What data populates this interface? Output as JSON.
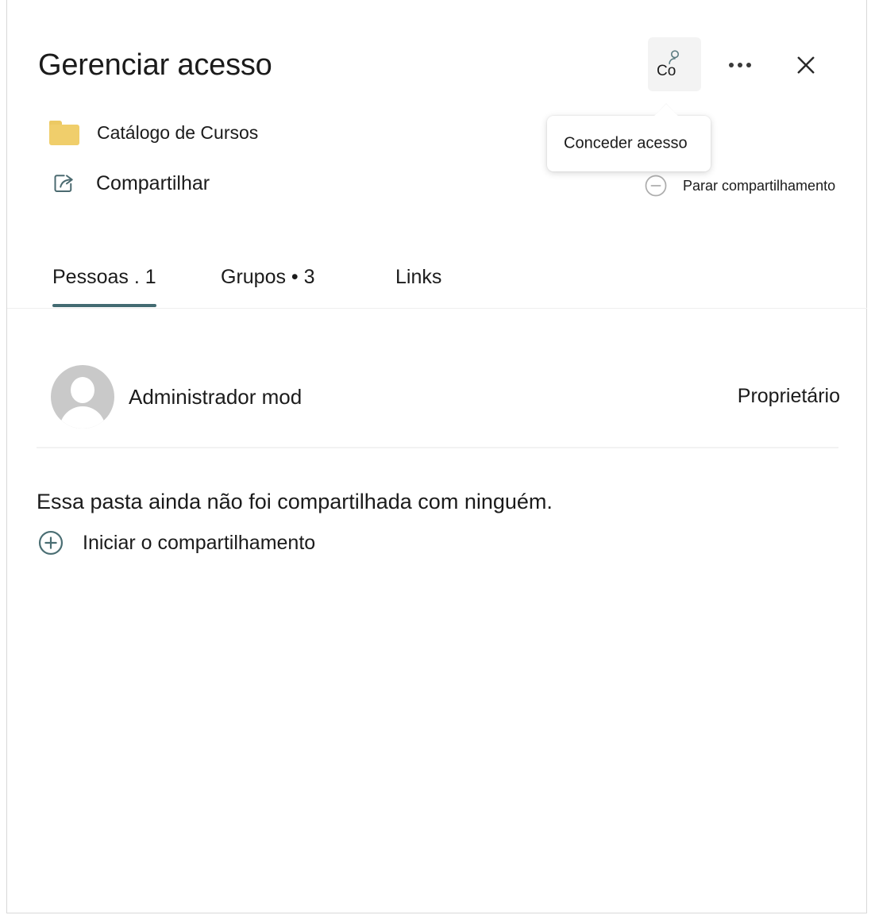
{
  "header": {
    "title": "Gerenciar acesso",
    "folder": {
      "icon": "folder-icon",
      "label": "Catálogo de Cursos"
    },
    "share": {
      "icon": "share-icon",
      "label": "Compartilhar"
    },
    "grant_access_button": {
      "icon": "person-add-icon",
      "clipped_label": "Co",
      "tooltip": "Conceder acesso"
    },
    "more_button": {
      "icon": "more-horizontal-icon",
      "label": "..."
    },
    "close_button": {
      "icon": "close-icon"
    },
    "stop_sharing": {
      "icon": "minus-circle-icon",
      "label": "Parar compartilhamento"
    }
  },
  "tabs": [
    {
      "label": "Pessoas . 1",
      "active": true
    },
    {
      "label": "Grupos • 3",
      "active": false
    },
    {
      "label": "Links",
      "active": false
    }
  ],
  "people": [
    {
      "avatar": "default-avatar-icon",
      "name": "Administrador mod",
      "role": "Proprietário"
    }
  ],
  "empty_state": {
    "message": "Essa pasta ainda não foi compartilhada com ninguém.",
    "action": {
      "icon": "plus-circle-icon",
      "label": "Iniciar o compartilhamento"
    }
  },
  "colors": {
    "accent": "#436b72",
    "folder": "#f0ce6b",
    "tooltip_bg": "#ffffff",
    "button_hover_bg": "#f3f3f3",
    "text": "#1b1b1b"
  }
}
